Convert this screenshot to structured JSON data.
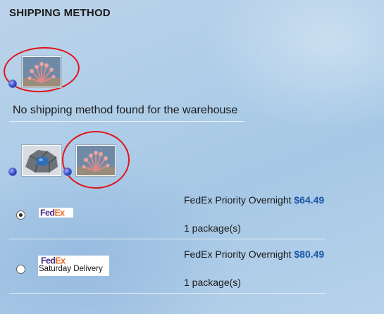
{
  "header": {
    "title": "SHIPPING METHOD"
  },
  "warehouse_1": {
    "message": "No shipping method found for the warehouse"
  },
  "methods": [
    {
      "carrier_logo": "FedEx",
      "service": "FedEx Priority Overnight",
      "price": "$64.49",
      "packages": "1 package(s)",
      "selected": true
    },
    {
      "carrier_logo": "FedEx",
      "logo_caption": "Saturday Delivery",
      "service": "FedEx Priority Overnight",
      "price": "$80.49",
      "packages": "1 package(s)",
      "selected": false
    }
  ],
  "colors": {
    "price": "#1a56a8",
    "annotation_circle": "#e0151b",
    "fedex_fed": "#4b2a86",
    "fedex_ex": "#ee6a1f"
  },
  "icons": [
    "coral-product-thumbnail",
    "rock-product-thumbnail",
    "annotation-circle"
  ]
}
